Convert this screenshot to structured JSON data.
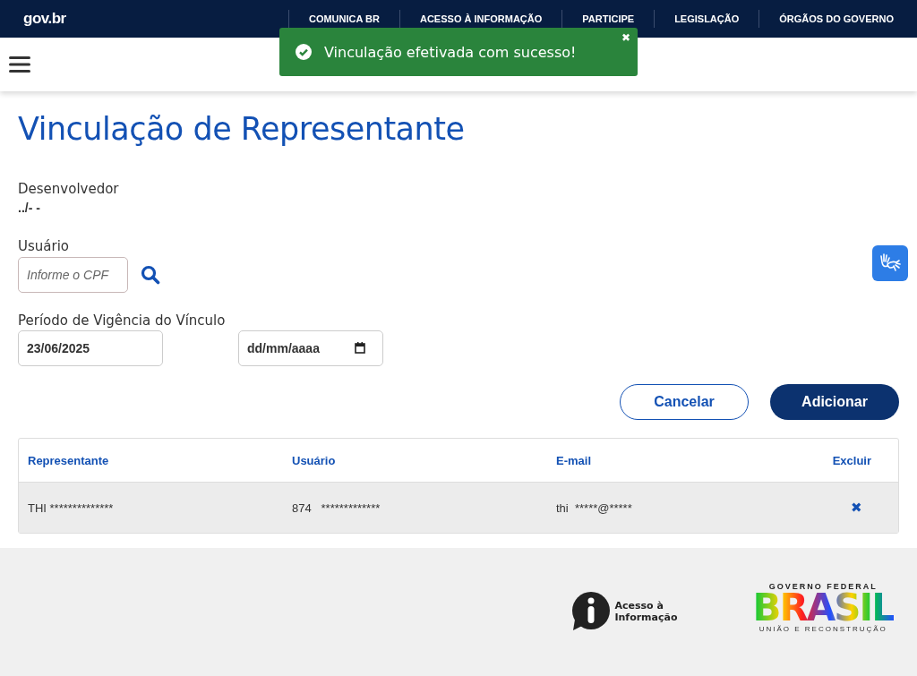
{
  "header": {
    "logo": "gov.br",
    "links": [
      "COMUNICA BR",
      "ACESSO À INFORMAÇÃO",
      "PARTICIPE",
      "LEGISLAÇÃO",
      "ÓRGÃOS DO GOVERNO"
    ]
  },
  "toast": {
    "kind": "success",
    "message": "Vinculação efetivada com sucesso!",
    "close": "✖"
  },
  "page_title": "Vinculação de Representante",
  "developer": {
    "label": "Desenvolvedor",
    "value": "../- -"
  },
  "user": {
    "label": "Usuário",
    "placeholder": "Informe o CPF"
  },
  "period": {
    "label": "Período de Vigência do Vínculo",
    "start": "23/06/2025",
    "end_placeholder": "dd/mm/aaaa"
  },
  "buttons": [
    {
      "label": "Cancelar",
      "kind": "secondary"
    },
    {
      "label": "Adicionar",
      "kind": "primary"
    }
  ],
  "table": {
    "columns": [
      "Representante",
      "Usuário",
      "E-mail",
      "Excluir"
    ],
    "rows": [
      {
        "representante": "THI **************",
        "usuario": "874   *************",
        "email": "thi  *****@*****",
        "delete": "✖"
      }
    ]
  },
  "footer": {
    "info": [
      "Acesso à",
      "Informação"
    ],
    "gov_top": "GOVERNO FEDERAL",
    "gov_word": "BRASIL",
    "gov_bottom": "UNIÃO E RECONSTRUÇÃO"
  }
}
